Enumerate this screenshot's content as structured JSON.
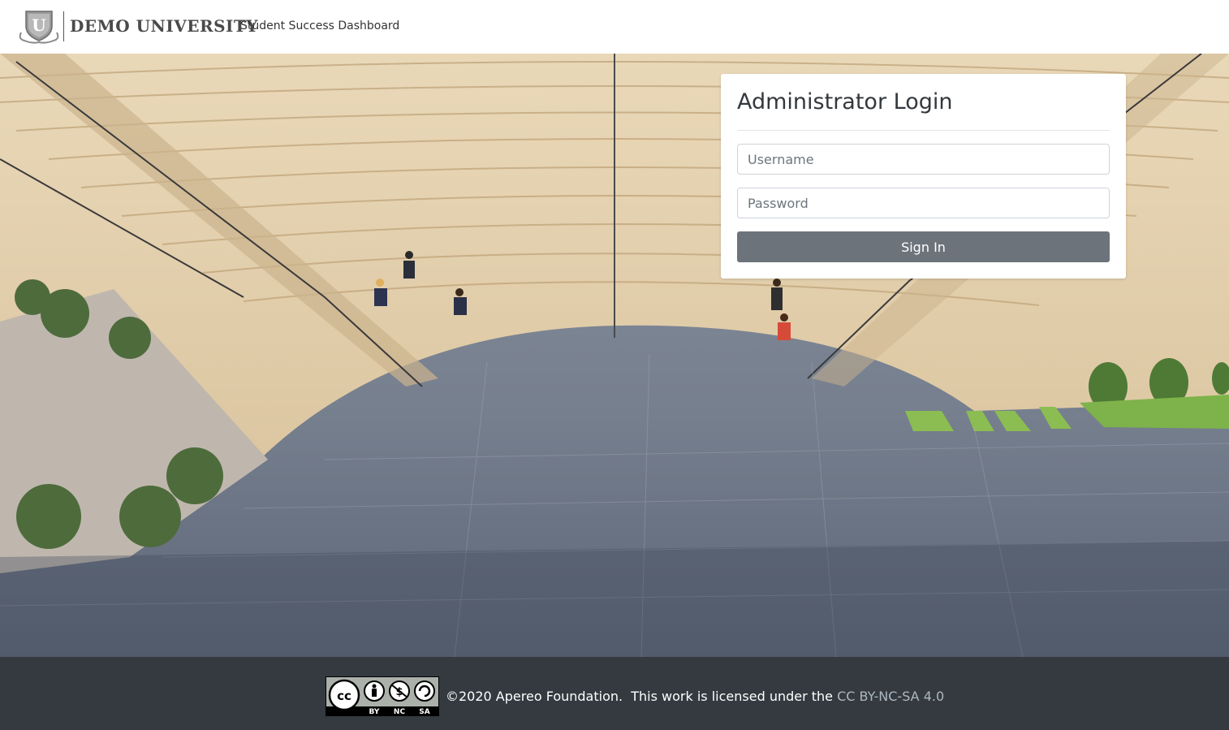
{
  "header": {
    "logo_letter": "U",
    "brand_name": "DEMO UNIVERSITY",
    "subtitle": "Student Success Dashboard"
  },
  "login": {
    "title": "Administrator Login",
    "username_placeholder": "Username",
    "password_placeholder": "Password",
    "sign_in_label": "Sign In"
  },
  "footer": {
    "cc_labels": [
      "BY",
      "NC",
      "SA"
    ],
    "copyright": "©2020 Apereo Foundation.  This work is licensed under the ",
    "license_link": "CC BY-NC-SA 4.0"
  },
  "colors": {
    "footer_bg": "#343a40",
    "button_bg": "#6c737b",
    "link": "#aeb8c2"
  }
}
